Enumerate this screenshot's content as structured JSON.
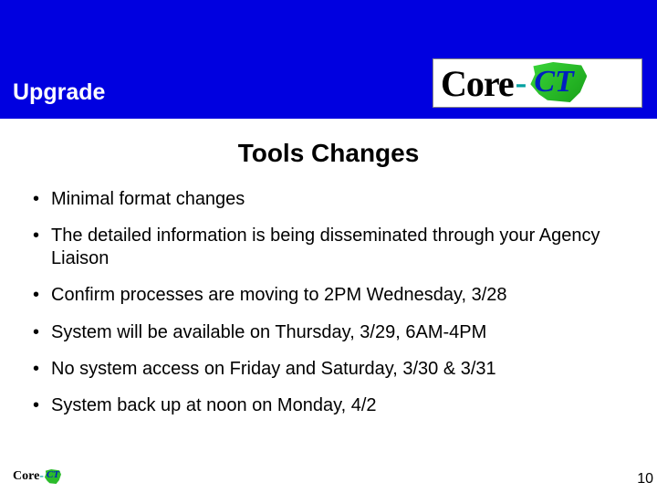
{
  "header": {
    "title": "Upgrade",
    "logo_core": "Core",
    "logo_dash": "-",
    "logo_ct": "CT"
  },
  "slide": {
    "title": "Tools Changes",
    "bullets": [
      "Minimal format changes",
      "The detailed information is being disseminated through your Agency Liaison",
      "Confirm processes are moving to 2PM Wednesday, 3/28",
      "System will be available on Thursday, 3/29, 6AM-4PM",
      "No system access on Friday and Saturday, 3/30 & 3/31",
      "System back up at noon on Monday, 4/2"
    ]
  },
  "footer": {
    "logo_core": "Core",
    "logo_dash": "-",
    "logo_ct": "CT",
    "page_number": "10"
  }
}
